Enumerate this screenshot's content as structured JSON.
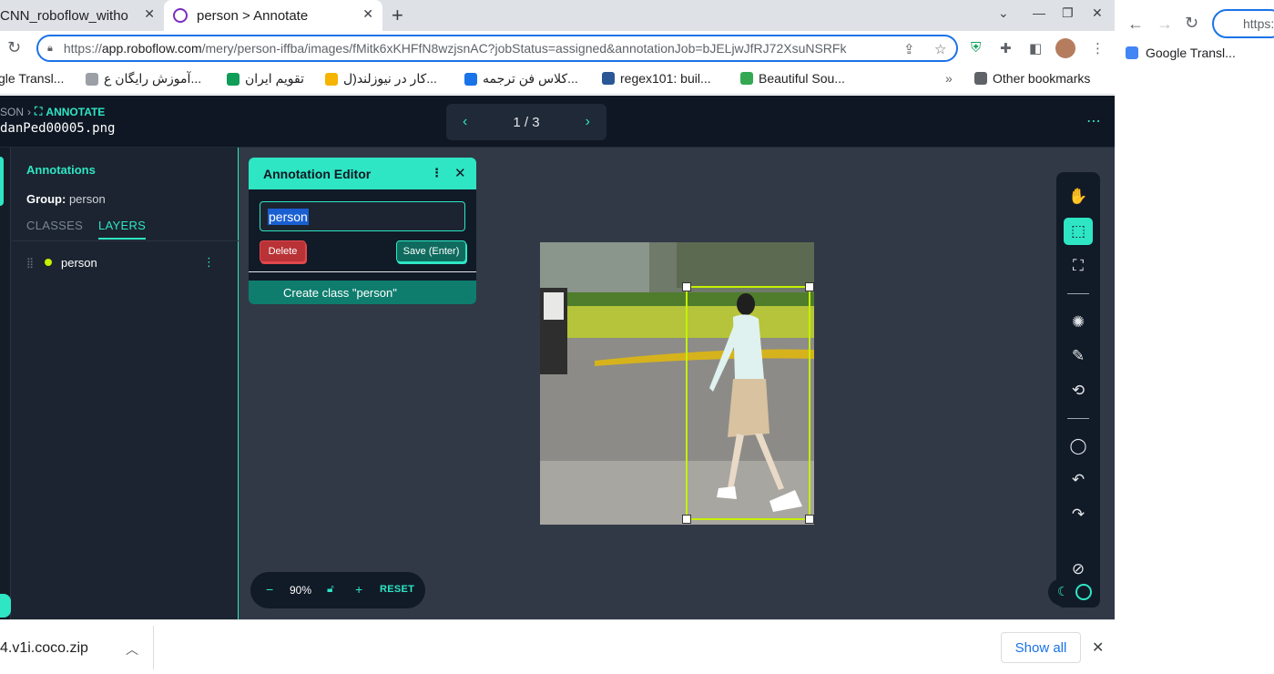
{
  "browser": {
    "tabs": [
      {
        "label": "CNN_roboflow_witho",
        "active": false
      },
      {
        "label": "person > Annotate",
        "active": true
      }
    ],
    "url_host": "app.roboflow.com",
    "url_rest": "/mery/person-iffba/images/fMitk6xKHFfN8wzjsnAC?jobStatus=assigned&annotationJob=bJELjwJfRJ72XsuNSRFk",
    "url_scheme": "https://",
    "bookmarks": [
      {
        "label": "gle Transl...",
        "color": "#4285f4"
      },
      {
        "label": "آموزش رایگان ع...",
        "color": "#9aa0a6"
      },
      {
        "label": "تقویم ایران",
        "color": "#0f9d58"
      },
      {
        "label": "کار در نیوزلند(ل...",
        "color": "#f4b400"
      },
      {
        "label": "کلاس فن ترجمه...",
        "color": "#1a73e8"
      },
      {
        "label": "regex101: buil...",
        "color": "#2b5797"
      },
      {
        "label": "Beautiful Sou...",
        "color": "#34a853"
      },
      {
        "label": "Other bookmarks",
        "color": "#5f6368"
      }
    ],
    "right_pane": {
      "url_fragment": "https:",
      "bookmark": "Google Transl..."
    }
  },
  "app": {
    "breadcrumb_parent": "SON",
    "breadcrumb_current": "ANNOTATE",
    "filename": "danPed00005.png",
    "pager": "1 / 3",
    "sidebar": {
      "title": "Annotations",
      "group_label": "Group:",
      "group_value": "person",
      "tab_classes": "CLASSES",
      "tab_layers": "LAYERS",
      "layers": [
        {
          "label": "person",
          "color": "#c6f000"
        }
      ]
    },
    "editor": {
      "title": "Annotation Editor",
      "input_value": "person",
      "delete_label": "Delete",
      "save_label": "Save (Enter)",
      "create_label": "Create class \"person\""
    },
    "zoom": {
      "minus": "−",
      "value": "90%",
      "plus": "+",
      "reset": "RESET"
    },
    "tools": [
      {
        "name": "hand-icon",
        "glyph": "✋"
      },
      {
        "name": "bounding-box-icon",
        "glyph": "⬚",
        "active": true
      },
      {
        "name": "polygon-icon",
        "glyph": "⛶"
      },
      {
        "name": "smart-select-icon",
        "glyph": "✺"
      },
      {
        "name": "magic-wand-icon",
        "glyph": "✎"
      },
      {
        "name": "repeat-icon",
        "glyph": "⟲"
      },
      {
        "name": "comment-icon",
        "glyph": "◯"
      },
      {
        "name": "undo-icon",
        "glyph": "↶"
      },
      {
        "name": "redo-icon",
        "glyph": "↷"
      },
      {
        "name": "hide-icon",
        "glyph": "⊘"
      }
    ]
  },
  "downloads": {
    "file": "4.v1i.coco.zip",
    "show_all": "Show all"
  },
  "colors": {
    "accent": "#2ee6c4",
    "bbox": "#c6f000",
    "delete": "#b83236"
  }
}
